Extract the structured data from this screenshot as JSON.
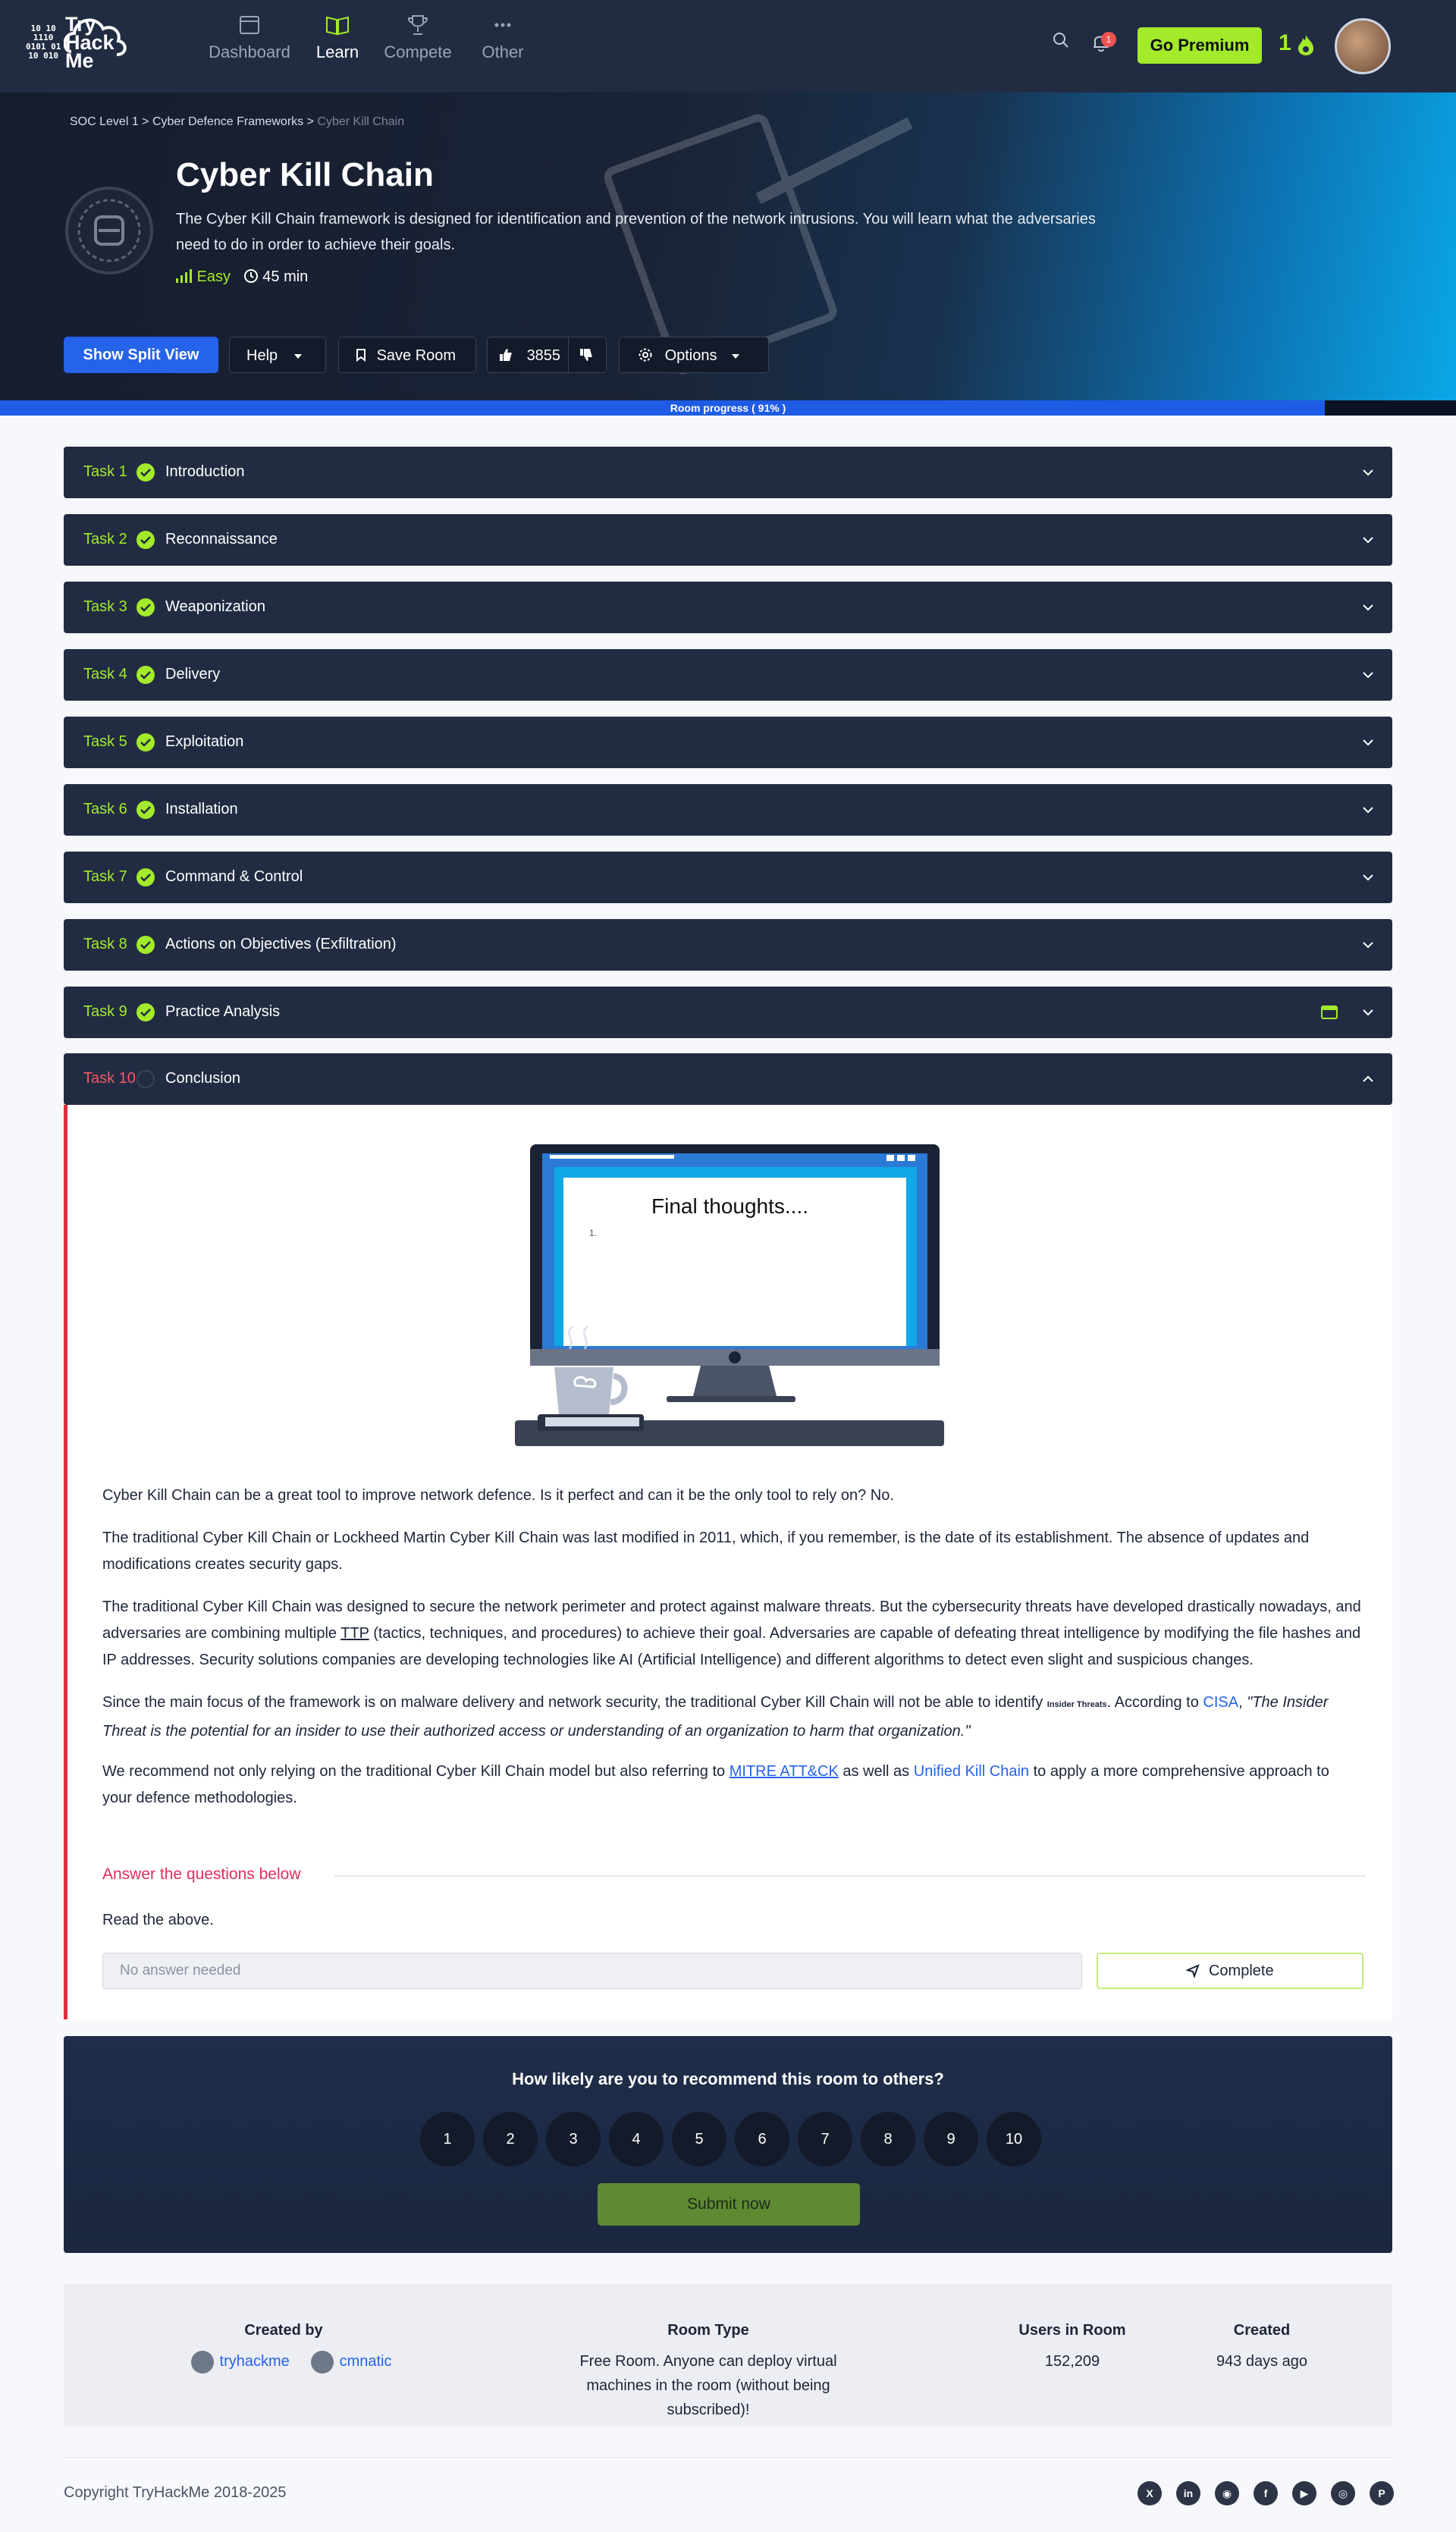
{
  "nav": {
    "logo_lines": [
      "Try",
      "Hack",
      "Me"
    ],
    "logo_binary": [
      "10 10",
      "1110",
      "0101 01",
      "10 010"
    ],
    "items": [
      {
        "label": "Dashboard",
        "icon": "dashboard-icon"
      },
      {
        "label": "Learn",
        "icon": "book-icon"
      },
      {
        "label": "Compete",
        "icon": "trophy-icon"
      },
      {
        "label": "Other",
        "icon": "more-icon"
      }
    ],
    "active_item": "Learn",
    "notification_count": "1",
    "premium_label": "Go Premium",
    "streak": "1"
  },
  "hero": {
    "breadcrumb": [
      "SOC Level 1",
      "Cyber Defence Frameworks",
      "Cyber Kill Chain"
    ],
    "breadcrumb_sep": ">",
    "title": "Cyber Kill Chain",
    "description": "The Cyber Kill Chain framework is designed for identification and prevention of the network intrusions. You will learn what the adversaries need to do in order to achieve their goals.",
    "difficulty": "Easy",
    "duration": "45 min",
    "buttons": {
      "split_view": "Show Split View",
      "help": "Help",
      "save": "Save Room",
      "likes": "3855",
      "options": "Options"
    }
  },
  "progress": {
    "label": "Room progress ( 91% )",
    "value": 91
  },
  "tasks": [
    {
      "num": "Task 1",
      "title": "Introduction",
      "done": true
    },
    {
      "num": "Task 2",
      "title": "Reconnaissance",
      "done": true
    },
    {
      "num": "Task 3",
      "title": "Weaponization",
      "done": true
    },
    {
      "num": "Task 4",
      "title": "Delivery",
      "done": true
    },
    {
      "num": "Task 5",
      "title": "Exploitation",
      "done": true
    },
    {
      "num": "Task 6",
      "title": "Installation",
      "done": true
    },
    {
      "num": "Task 7",
      "title": "Command & Control",
      "done": true
    },
    {
      "num": "Task 8",
      "title": "Actions on Objectives (Exfiltration)",
      "done": true
    },
    {
      "num": "Task 9",
      "title": "Practice Analysis",
      "done": true
    },
    {
      "num": "Task 10",
      "title": "Conclusion",
      "done": false
    }
  ],
  "conclusion": {
    "image_text": "Final thoughts....",
    "image_list_marker": "1.",
    "p1": "Cyber Kill Chain can be a great tool to improve network defence. Is it perfect and can it be the only tool to rely on? No.",
    "p2": "The traditional Cyber Kill Chain or Lockheed Martin Cyber Kill Chain was last modified in 2011, which, if you remember, is the date of its establishment. The absence of updates and modifications creates security gaps.",
    "p3_a": "The traditional Cyber Kill Chain was designed to secure the network perimeter and protect against malware threats. But the cybersecurity threats have developed drastically nowadays, and adversaries are combining multiple ",
    "p3_ttp": "TTP",
    "p3_b": " (tactics, techniques, and procedures) to achieve their goal. Adversaries are capable of defeating threat intelligence by modifying the file hashes and IP addresses. Security solutions companies are developing technologies like AI (Artificial Intelligence) and different algorithms to detect even slight and suspicious changes.",
    "p4_a": "Since the main focus of the framework is on malware delivery and network security, the traditional Cyber Kill Chain will not be able to identify ",
    "p4_small": "Insider Threats",
    "p4_b": ". According to ",
    "p4_link": "CISA",
    "p4_c": ", ",
    "p4_quote": "\"The Insider Threat is the potential for an insider to use their authorized access or understanding of an organization to harm that organization.\"",
    "p5_a": "We recommend not only relying on the traditional Cyber Kill Chain model but also referring to ",
    "p5_link1": "MITRE ATT&CK",
    "p5_b": " as well as ",
    "p5_link2": "Unified Kill Chain",
    "p5_c": " to apply a more comprehensive approach to your defence methodologies.",
    "answer_heading": "Answer the questions below",
    "question": "Read the above.",
    "answer_placeholder": "No answer needed",
    "complete_label": "Complete"
  },
  "rating": {
    "question": "How likely are you to recommend this room to others?",
    "options": [
      "1",
      "2",
      "3",
      "4",
      "5",
      "6",
      "7",
      "8",
      "9",
      "10"
    ],
    "submit": "Submit now"
  },
  "info": {
    "created_by_label": "Created by",
    "creators": [
      "tryhackme",
      "cmnatic"
    ],
    "room_type_label": "Room Type",
    "room_type": "Free Room. Anyone can deploy virtual machines in the room (without being subscribed)!",
    "users_label": "Users in Room",
    "users": "152,209",
    "created_label": "Created",
    "created": "943 days ago"
  },
  "footer": {
    "copyright": "Copyright TryHackMe 2018-2025",
    "social": [
      "x-icon",
      "linkedin-icon",
      "discord-icon",
      "facebook-icon",
      "youtube-icon",
      "instagram-icon",
      "pinterest-icon"
    ]
  },
  "colors": {
    "accent": "#a3ea2a",
    "primary": "#2563eb",
    "navy": "#212c42",
    "danger": "#e02d3c"
  }
}
